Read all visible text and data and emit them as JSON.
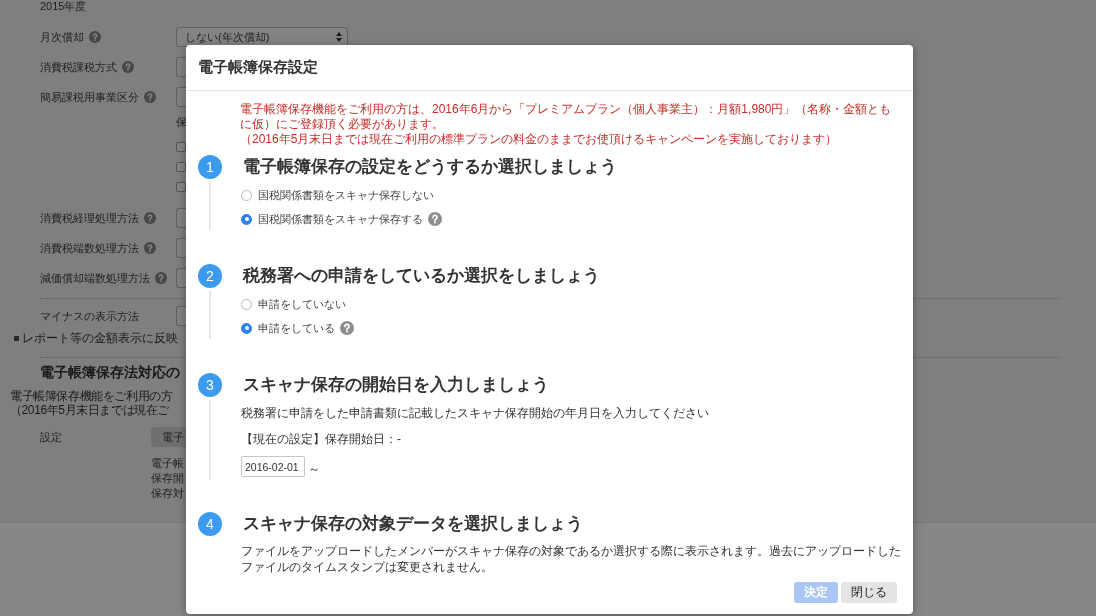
{
  "background_page": {
    "fiscal_year": "2015年度",
    "settings": [
      {
        "kind": "select",
        "label": "月次償却",
        "help": true,
        "value": "しない(年次償却)"
      },
      {
        "kind": "select",
        "label": "消費税課税方式",
        "help": true
      },
      {
        "kind": "select",
        "label": "簡易課税用事業区分",
        "help": true
      },
      {
        "kind": "text",
        "text": "保"
      },
      {
        "kind": "checkbox",
        "checked": false
      },
      {
        "kind": "checkbox",
        "checked": false
      },
      {
        "kind": "checkbox",
        "checked": false
      },
      {
        "kind": "select",
        "label": "消費税経理処理方法",
        "help": true
      },
      {
        "kind": "select",
        "label": "消費税端数処理方法",
        "help": true
      },
      {
        "kind": "select",
        "label": "減価償却端数処理方法",
        "help": true
      },
      {
        "kind": "divider"
      },
      {
        "kind": "select",
        "label": "マイナスの表示方法",
        "help": false,
        "note": "レポート等の金額表示に反映"
      },
      {
        "kind": "divider"
      }
    ],
    "section": {
      "title": "電子帳簿保存法対応の",
      "description": [
        "電子帳簿保存機能をご利用の方",
        "（2016年5月末日までは現在ご"
      ],
      "setting_label": "設定",
      "button": "電子",
      "details": [
        "電子帳",
        "保存開",
        "保存対"
      ]
    }
  },
  "dialog": {
    "title": "電子帳簿保存設定",
    "notice": [
      "電子帳簿保存機能をご利用の方は、2016年6月から「プレミアムプラン（個人事業主）：月額1,980円」（名称・金額ともに仮）にご登録頂く必要があります。",
      "（2016年5月末日までは現在ご利用の標準プランの料金のままでお使頂けるキャンペーンを実施しております）"
    ],
    "steps": [
      {
        "number": "1",
        "title": "電子帳簿保存の設定をどうするか選択しましょう",
        "kind": "radio",
        "options": [
          {
            "label": "国税関係書類をスキャナ保存しない",
            "selected": false,
            "help": false
          },
          {
            "label": "国税関係書類をスキャナ保存する",
            "selected": true,
            "help": true
          }
        ]
      },
      {
        "number": "2",
        "title": "税務署への申請をしているか選択をしましょう",
        "kind": "radio",
        "options": [
          {
            "label": "申請をしていない",
            "selected": false,
            "help": false
          },
          {
            "label": "申請をしている",
            "selected": true,
            "help": true
          }
        ]
      },
      {
        "number": "3",
        "title": "スキャナ保存の開始日を入力しましょう",
        "kind": "date",
        "description": "税務署に申請をした申請書類に記載したスキャナ保存開始の年月日を入力してください",
        "current_setting": "【現在の設定】保存開始日：-",
        "date_value": "2016-02-01",
        "range_mark": "～"
      },
      {
        "number": "4",
        "title": "スキャナ保存の対象データを選択しましょう",
        "kind": "text",
        "description": "ファイルをアップロードしたメンバーがスキャナ保存の対象であるか選択する際に表示されます。過去にアップロードしたファイルのタイムスタンプは変更されません。"
      }
    ],
    "buttons": [
      {
        "label": "決定",
        "kind": "primary",
        "disabled": true
      },
      {
        "label": "閉じる",
        "kind": "secondary",
        "disabled": false
      }
    ]
  }
}
